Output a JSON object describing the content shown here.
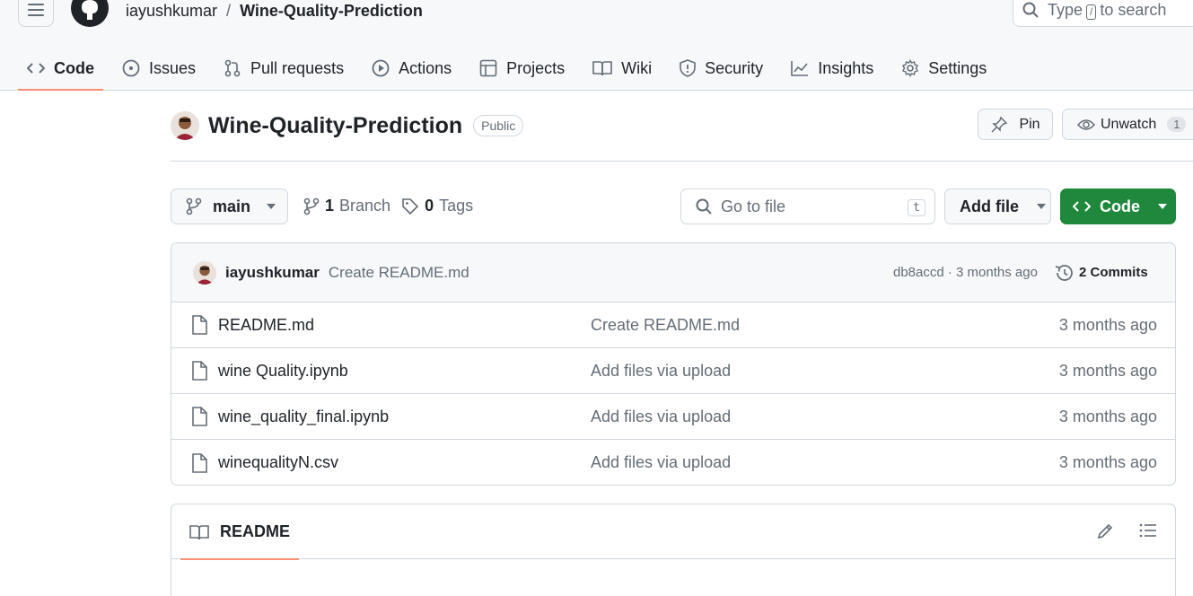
{
  "header": {
    "owner": "iayushkumar",
    "separator": "/",
    "repo": "Wine-Quality-Prediction",
    "search_prefix": "Type",
    "search_key": "/",
    "search_suffix": "to search"
  },
  "tabs": [
    {
      "label": "Code",
      "icon": "code-icon"
    },
    {
      "label": "Issues",
      "icon": "issue-icon"
    },
    {
      "label": "Pull requests",
      "icon": "pull-request-icon"
    },
    {
      "label": "Actions",
      "icon": "play-icon"
    },
    {
      "label": "Projects",
      "icon": "table-icon"
    },
    {
      "label": "Wiki",
      "icon": "book-icon"
    },
    {
      "label": "Security",
      "icon": "shield-icon"
    },
    {
      "label": "Insights",
      "icon": "graph-icon"
    },
    {
      "label": "Settings",
      "icon": "gear-icon"
    }
  ],
  "repo": {
    "title": "Wine-Quality-Prediction",
    "visibility": "Public",
    "pin_label": "Pin",
    "watch_label": "Unwatch",
    "watch_count": "1"
  },
  "toolbar": {
    "branch": "main",
    "branch_count": "1",
    "branch_word": "Branch",
    "tag_count": "0",
    "tag_word": "Tags",
    "goto_placeholder": "Go to file",
    "goto_key": "t",
    "add_file": "Add file",
    "code": "Code"
  },
  "latest_commit": {
    "author": "iayushkumar",
    "message": "Create README.md",
    "meta": "db8accd · 3 months ago",
    "commits": "2 Commits"
  },
  "files": [
    {
      "name": "README.md",
      "message": "Create README.md",
      "time": "3 months ago"
    },
    {
      "name": "wine Quality.ipynb",
      "message": "Add files via upload",
      "time": "3 months ago"
    },
    {
      "name": "wine_quality_final.ipynb",
      "message": "Add files via upload",
      "time": "3 months ago"
    },
    {
      "name": "winequalityN.csv",
      "message": "Add files via upload",
      "time": "3 months ago"
    }
  ],
  "readme": {
    "tab_label": "README"
  },
  "colors": {
    "accent": "#fd8c73",
    "primary_button": "#1f883d",
    "border": "#d0d7de",
    "muted_text": "#656d76"
  }
}
